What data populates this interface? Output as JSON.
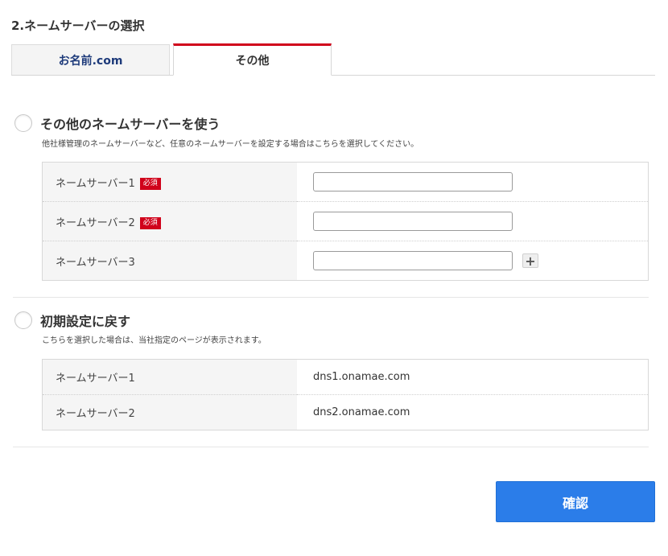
{
  "heading": "2.ネームサーバーの選択",
  "tabs": [
    {
      "label": "お名前.com"
    },
    {
      "label": "その他"
    }
  ],
  "other_ns": {
    "title": "その他のネームサーバーを使う",
    "description": "他社様管理のネームサーバーなど、任意のネームサーバーを設定する場合はこちらを選択してください。",
    "required_badge": "必須",
    "rows": [
      {
        "label": "ネームサーバー1",
        "value": ""
      },
      {
        "label": "ネームサーバー2",
        "value": ""
      },
      {
        "label": "ネームサーバー3",
        "value": ""
      }
    ],
    "add_label": "+"
  },
  "default_ns": {
    "title": "初期設定に戻す",
    "description": "こちらを選択した場合は、当社指定のページが表示されます。",
    "rows": [
      {
        "label": "ネームサーバー1",
        "value": "dns1.onamae.com"
      },
      {
        "label": "ネームサーバー2",
        "value": "dns2.onamae.com"
      }
    ]
  },
  "confirm_label": "確認",
  "colors": {
    "accent_red": "#d0021b",
    "button_blue": "#2b7de9",
    "tab_text_blue": "#1d3a7a"
  }
}
